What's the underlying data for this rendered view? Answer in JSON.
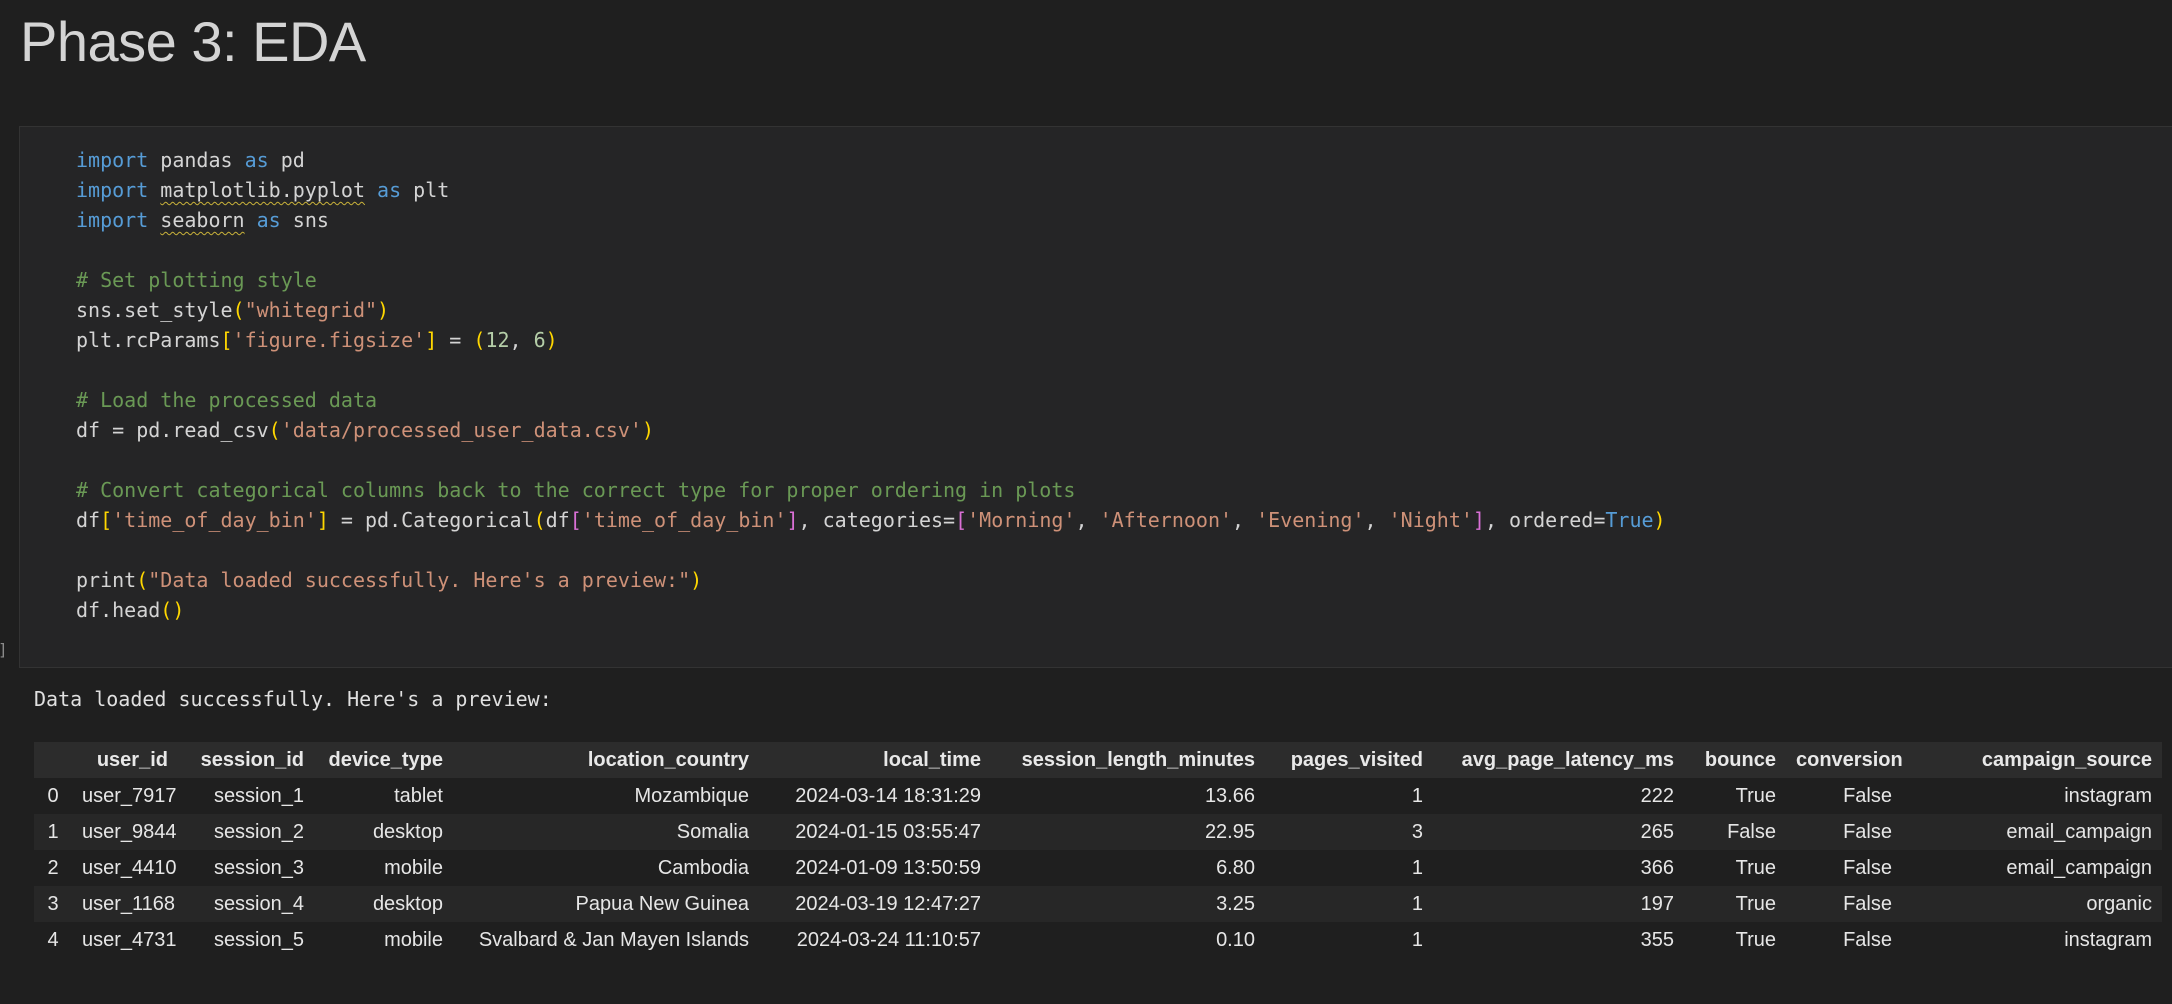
{
  "heading": "Phase 3: EDA",
  "cell_marker": "]",
  "code_cell": {
    "lines": [
      [
        {
          "t": "import",
          "c": "kw"
        },
        {
          "t": " pandas "
        },
        {
          "t": "as",
          "c": "kw"
        },
        {
          "t": " pd"
        }
      ],
      [
        {
          "t": "import",
          "c": "kw"
        },
        {
          "t": " "
        },
        {
          "t": "matplotlib.pyplot",
          "c": "sq"
        },
        {
          "t": " "
        },
        {
          "t": "as",
          "c": "kw"
        },
        {
          "t": " plt"
        }
      ],
      [
        {
          "t": "import",
          "c": "kw"
        },
        {
          "t": " "
        },
        {
          "t": "seaborn",
          "c": "sq"
        },
        {
          "t": " "
        },
        {
          "t": "as",
          "c": "kw"
        },
        {
          "t": " sns"
        }
      ],
      [],
      [
        {
          "t": "# Set plotting style",
          "c": "cm"
        }
      ],
      [
        {
          "t": "sns.set_style"
        },
        {
          "t": "(",
          "c": "p1"
        },
        {
          "t": "\"whitegrid\"",
          "c": "st"
        },
        {
          "t": ")",
          "c": "p1"
        }
      ],
      [
        {
          "t": "plt.rcParams"
        },
        {
          "t": "[",
          "c": "p1"
        },
        {
          "t": "'figure.figsize'",
          "c": "st"
        },
        {
          "t": "]",
          "c": "p1"
        },
        {
          "t": " = "
        },
        {
          "t": "(",
          "c": "p1"
        },
        {
          "t": "12",
          "c": "nm"
        },
        {
          "t": ", "
        },
        {
          "t": "6",
          "c": "nm"
        },
        {
          "t": ")",
          "c": "p1"
        }
      ],
      [],
      [
        {
          "t": "# Load the processed data",
          "c": "cm"
        }
      ],
      [
        {
          "t": "df = pd.read_csv"
        },
        {
          "t": "(",
          "c": "p1"
        },
        {
          "t": "'data/processed_user_data.csv'",
          "c": "st"
        },
        {
          "t": ")",
          "c": "p1"
        }
      ],
      [],
      [
        {
          "t": "# Convert categorical columns back to the correct type for proper ordering in plots",
          "c": "cm"
        }
      ],
      [
        {
          "t": "df"
        },
        {
          "t": "[",
          "c": "p1"
        },
        {
          "t": "'time_of_day_bin'",
          "c": "st"
        },
        {
          "t": "]",
          "c": "p1"
        },
        {
          "t": " = pd.Categorical"
        },
        {
          "t": "(",
          "c": "p1"
        },
        {
          "t": "df"
        },
        {
          "t": "[",
          "c": "p2"
        },
        {
          "t": "'time_of_day_bin'",
          "c": "st"
        },
        {
          "t": "]",
          "c": "p2"
        },
        {
          "t": ", categories="
        },
        {
          "t": "[",
          "c": "p2"
        },
        {
          "t": "'Morning'",
          "c": "st"
        },
        {
          "t": ", "
        },
        {
          "t": "'Afternoon'",
          "c": "st"
        },
        {
          "t": ", "
        },
        {
          "t": "'Evening'",
          "c": "st"
        },
        {
          "t": ", "
        },
        {
          "t": "'Night'",
          "c": "st"
        },
        {
          "t": "]",
          "c": "p2"
        },
        {
          "t": ", ordered="
        },
        {
          "t": "True",
          "c": "kw"
        },
        {
          "t": ")",
          "c": "p1"
        }
      ],
      [],
      [
        {
          "t": "print"
        },
        {
          "t": "(",
          "c": "p1"
        },
        {
          "t": "\"Data loaded successfully. Here's a preview:\"",
          "c": "st"
        },
        {
          "t": ")",
          "c": "p1"
        }
      ],
      [
        {
          "t": "df.head"
        },
        {
          "t": "()",
          "c": "p1"
        }
      ]
    ]
  },
  "output": {
    "text": "Data loaded successfully. Here's a preview:",
    "table": {
      "columns": [
        "",
        "user_id",
        "session_id",
        "device_type",
        "location_country",
        "local_time",
        "session_length_minutes",
        "pages_visited",
        "avg_page_latency_ms",
        "bounce",
        "conversion",
        "campaign_source"
      ],
      "rows": [
        [
          "0",
          "user_7917",
          "session_1",
          "tablet",
          "Mozambique",
          "2024-03-14 18:31:29",
          "13.66",
          "1",
          "222",
          "True",
          "False",
          "instagram"
        ],
        [
          "1",
          "user_9844",
          "session_2",
          "desktop",
          "Somalia",
          "2024-01-15 03:55:47",
          "22.95",
          "3",
          "265",
          "False",
          "False",
          "email_campaign"
        ],
        [
          "2",
          "user_4410",
          "session_3",
          "mobile",
          "Cambodia",
          "2024-01-09 13:50:59",
          "6.80",
          "1",
          "366",
          "True",
          "False",
          "email_campaign"
        ],
        [
          "3",
          "user_1168",
          "session_4",
          "desktop",
          "Papua New Guinea",
          "2024-03-19 12:47:27",
          "3.25",
          "1",
          "197",
          "True",
          "False",
          "organic"
        ],
        [
          "4",
          "user_4731",
          "session_5",
          "mobile",
          "Svalbard & Jan Mayen Islands",
          "2024-03-24 11:10:57",
          "0.10",
          "1",
          "355",
          "True",
          "False",
          "instagram"
        ]
      ]
    }
  }
}
